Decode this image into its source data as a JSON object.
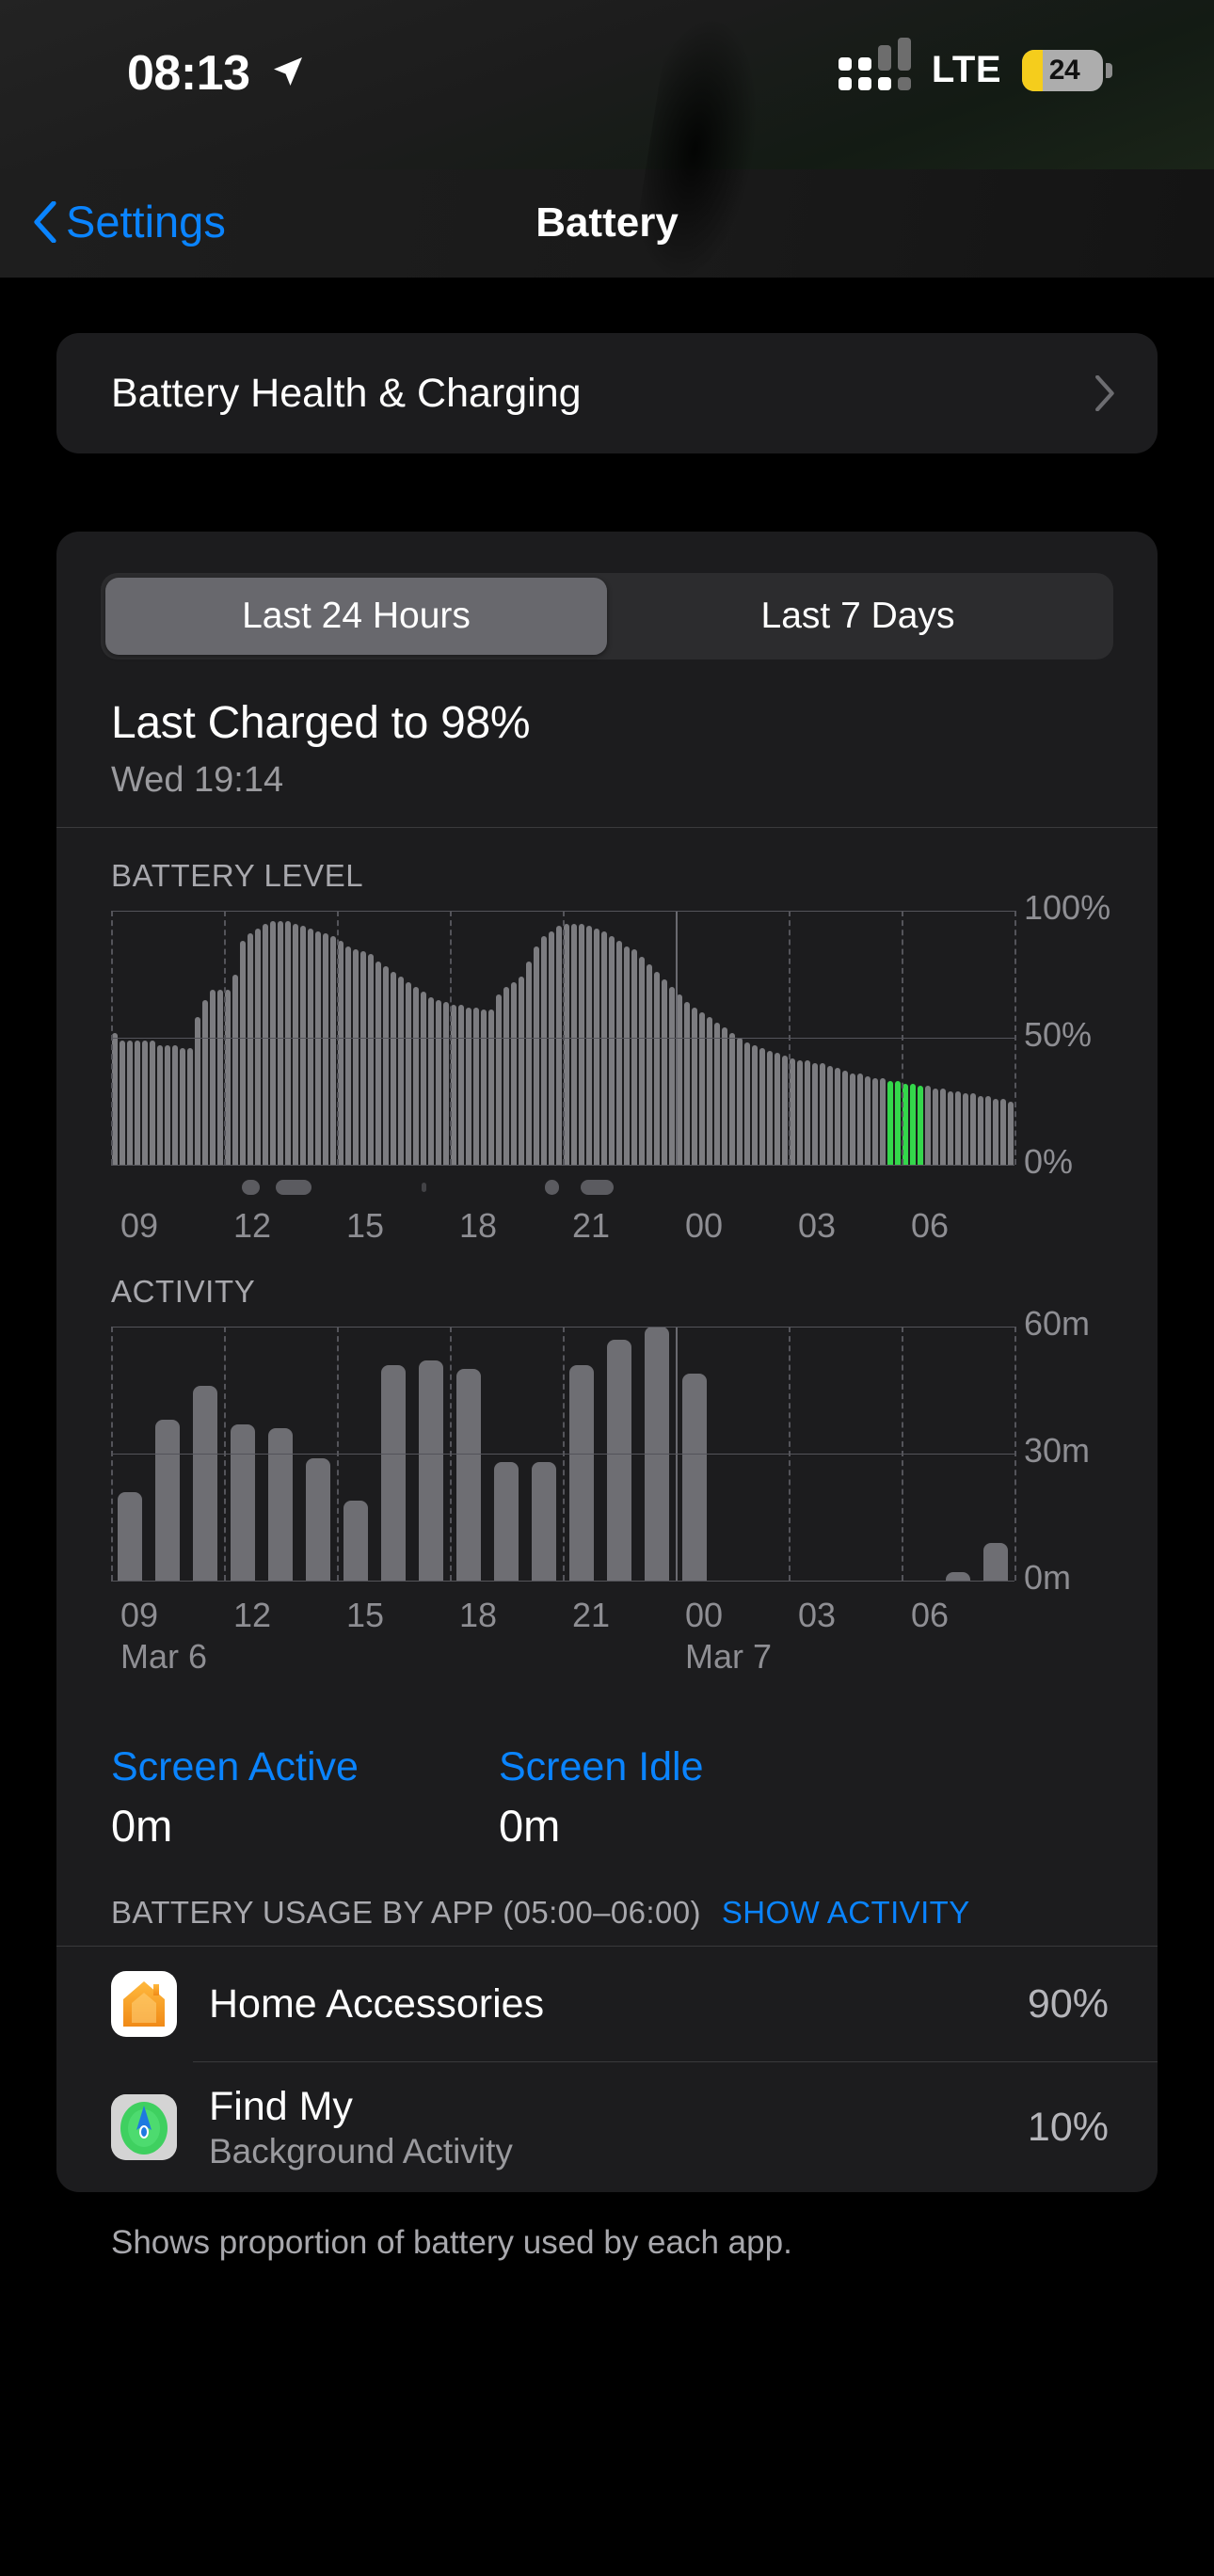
{
  "statusbar": {
    "time": "08:13",
    "location_icon": "location-arrow-icon",
    "signal_icon": "cellular-signal-icon",
    "network": "LTE",
    "battery_percent": "24",
    "battery_color": "#f5cd1c"
  },
  "nav": {
    "back_label": "Settings",
    "back_icon": "chevron-left-icon",
    "title": "Battery"
  },
  "health": {
    "label": "Battery Health & Charging",
    "chevron_icon": "chevron-right-icon"
  },
  "segmented": {
    "options": [
      "Last 24 Hours",
      "Last 7 Days"
    ],
    "selected_index": 0
  },
  "last_charged": {
    "title": "Last Charged to 98%",
    "subtitle": "Wed 19:14"
  },
  "screen": {
    "active_label": "Screen Active",
    "active_value": "0m",
    "idle_label": "Screen Idle",
    "idle_value": "0m"
  },
  "usage": {
    "header": "BATTERY USAGE BY APP (05:00–06:00)",
    "action": "SHOW ACTIVITY",
    "apps": [
      {
        "name": "Home Accessories",
        "subtitle": "",
        "percent": "90%",
        "icon": "home-app-icon"
      },
      {
        "name": "Find My",
        "subtitle": "Background Activity",
        "percent": "10%",
        "icon": "findmy-app-icon"
      }
    ],
    "footer": "Shows proportion of battery used by each app."
  },
  "chart_data": [
    {
      "type": "bar",
      "title": "BATTERY LEVEL",
      "ylabel": "",
      "xlabel": "",
      "ylim": [
        0,
        100
      ],
      "yticks": [
        "0%",
        "50%",
        "100%"
      ],
      "ytick_values": [
        0,
        50,
        100
      ],
      "xticks": [
        "09",
        "12",
        "15",
        "18",
        "21",
        "00",
        "03",
        "06"
      ],
      "grid": true,
      "charging_color": "#34d74b",
      "bar_color": "#7c7c80",
      "x": [
        "08:00",
        "08:12",
        "08:24",
        "08:36",
        "08:48",
        "09:00",
        "09:12",
        "09:24",
        "09:36",
        "09:48",
        "10:00",
        "10:12",
        "10:24",
        "10:36",
        "10:48",
        "11:00",
        "11:12",
        "11:24",
        "11:36",
        "11:48",
        "12:00",
        "12:12",
        "12:24",
        "12:36",
        "12:48",
        "13:00",
        "13:12",
        "13:24",
        "13:36",
        "13:48",
        "14:00",
        "14:12",
        "14:24",
        "14:36",
        "14:48",
        "15:00",
        "15:12",
        "15:24",
        "15:36",
        "15:48",
        "16:00",
        "16:12",
        "16:24",
        "16:36",
        "16:48",
        "17:00",
        "17:12",
        "17:24",
        "17:36",
        "17:48",
        "18:00",
        "18:12",
        "18:24",
        "18:36",
        "18:48",
        "19:00",
        "19:12",
        "19:24",
        "19:36",
        "19:48",
        "20:00",
        "20:12",
        "20:24",
        "20:36",
        "20:48",
        "21:00",
        "21:12",
        "21:24",
        "21:36",
        "21:48",
        "22:00",
        "22:12",
        "22:24",
        "22:36",
        "22:48",
        "23:00",
        "23:12",
        "23:24",
        "23:36",
        "23:48",
        "00:00",
        "00:12",
        "00:24",
        "00:36",
        "00:48",
        "01:00",
        "01:12",
        "01:24",
        "01:36",
        "01:48",
        "02:00",
        "02:12",
        "02:24",
        "02:36",
        "02:48",
        "03:00",
        "03:12",
        "03:24",
        "03:36",
        "03:48",
        "04:00",
        "04:12",
        "04:24",
        "04:36",
        "04:48",
        "05:00",
        "05:12",
        "05:24",
        "05:36",
        "05:48",
        "06:00",
        "06:12",
        "06:24",
        "06:36",
        "06:48",
        "07:00",
        "07:12",
        "07:24",
        "07:36",
        "07:48"
      ],
      "values": [
        52,
        49,
        49,
        49,
        49,
        49,
        47,
        47,
        47,
        46,
        46,
        58,
        65,
        69,
        69,
        69,
        75,
        88,
        91,
        93,
        95,
        96,
        96,
        96,
        95,
        94,
        93,
        92,
        91,
        90,
        88,
        86,
        85,
        84,
        83,
        80,
        78,
        76,
        74,
        72,
        70,
        68,
        66,
        65,
        64,
        63,
        63,
        62,
        62,
        61,
        61,
        67,
        70,
        72,
        74,
        80,
        86,
        90,
        92,
        94,
        95,
        95,
        95,
        94,
        93,
        92,
        90,
        88,
        86,
        85,
        82,
        79,
        76,
        73,
        70,
        67,
        64,
        62,
        60,
        58,
        56,
        54,
        52,
        50,
        48,
        47,
        46,
        45,
        44,
        43,
        42,
        41,
        41,
        40,
        40,
        39,
        38,
        37,
        36,
        36,
        35,
        34,
        34,
        33,
        33,
        32,
        32,
        31,
        31,
        30,
        30,
        29,
        29,
        28,
        28,
        27,
        27,
        26,
        26,
        25
      ],
      "charging_indices": [
        103,
        104,
        105,
        106,
        107
      ]
    },
    {
      "type": "bar",
      "title": "ACTIVITY",
      "ylabel": "",
      "xlabel": "",
      "ylim": [
        0,
        60
      ],
      "yticks": [
        "0m",
        "30m",
        "60m"
      ],
      "ytick_values": [
        0,
        30,
        60
      ],
      "xticks": [
        "09",
        "12",
        "15",
        "18",
        "21",
        "00",
        "03",
        "06"
      ],
      "day_labels": [
        "Mar 6",
        "Mar 7"
      ],
      "grid": true,
      "bar_color": "#6e6e73",
      "unit": "m",
      "x": [
        "08",
        "09",
        "10",
        "11",
        "12",
        "13",
        "14",
        "15",
        "16",
        "17",
        "18",
        "19",
        "20",
        "21",
        "22",
        "23",
        "00",
        "01",
        "02",
        "03",
        "04",
        "05",
        "06",
        "07"
      ],
      "values": [
        21,
        38,
        46,
        37,
        36,
        29,
        19,
        51,
        52,
        50,
        28,
        28,
        51,
        57,
        60,
        49,
        0,
        0,
        0,
        0,
        0,
        0,
        2,
        9
      ]
    }
  ]
}
